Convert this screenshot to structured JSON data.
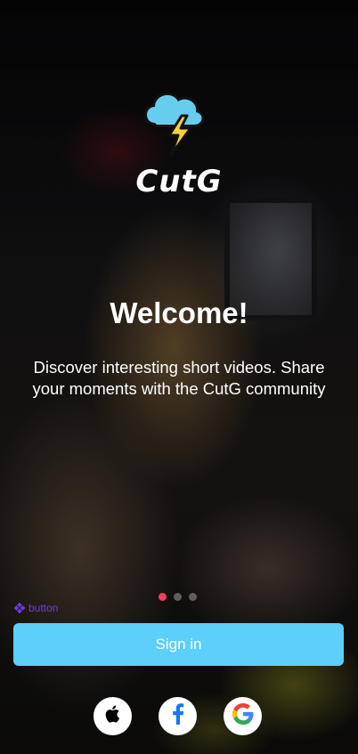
{
  "app": {
    "brand_name": "CutG",
    "logo_icon": "cloud-lightning-icon"
  },
  "hero": {
    "title": "Welcome!",
    "subtitle": "Discover interesting short videos. Share your moments with the CutG community"
  },
  "carousel": {
    "total_pages": 3,
    "active_index": 0,
    "active_color": "#ff3b5c",
    "inactive_color": "#bebebe"
  },
  "dev_overlay": {
    "label": "button",
    "icon": "component-diamond-icon",
    "color": "#7b3cff"
  },
  "signin": {
    "label": "Sign in",
    "color": "#5ccffb"
  },
  "social_login": [
    {
      "name": "Apple",
      "icon": "apple-icon"
    },
    {
      "name": "Facebook",
      "icon": "facebook-icon",
      "color": "#1877f2"
    },
    {
      "name": "Google",
      "icon": "google-icon"
    }
  ]
}
